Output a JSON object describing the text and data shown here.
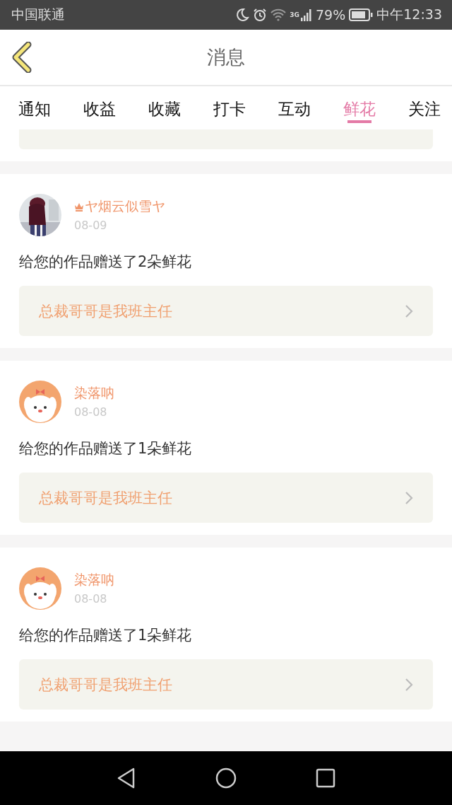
{
  "status_bar": {
    "carrier": "中国联通",
    "network": "3G",
    "battery": "79%",
    "time": "中午12:33"
  },
  "header": {
    "title": "消息"
  },
  "tabs": [
    {
      "label": "通知",
      "selected": false
    },
    {
      "label": "收益",
      "selected": false
    },
    {
      "label": "收藏",
      "selected": false
    },
    {
      "label": "打卡",
      "selected": false
    },
    {
      "label": "互动",
      "selected": false
    },
    {
      "label": "鲜花",
      "selected": true
    },
    {
      "label": "关注",
      "selected": false
    }
  ],
  "messages": [
    {
      "crown": true,
      "name": "ヤ烟云似雪ヤ",
      "date": "08-09",
      "text": "给您的作品赠送了2朵鲜花",
      "work": "总裁哥哥是我班主任"
    },
    {
      "kind": "cartoon",
      "crown": false,
      "name": "染落呐",
      "date": "08-08",
      "text": "给您的作品赠送了1朵鲜花",
      "work": "总裁哥哥是我班主任"
    },
    {
      "kind": "cartoon",
      "crown": false,
      "name": "染落呐",
      "date": "08-08",
      "text": "给您的作品赠送了1朵鲜花",
      "work": "总裁哥哥是我班主任"
    }
  ]
}
